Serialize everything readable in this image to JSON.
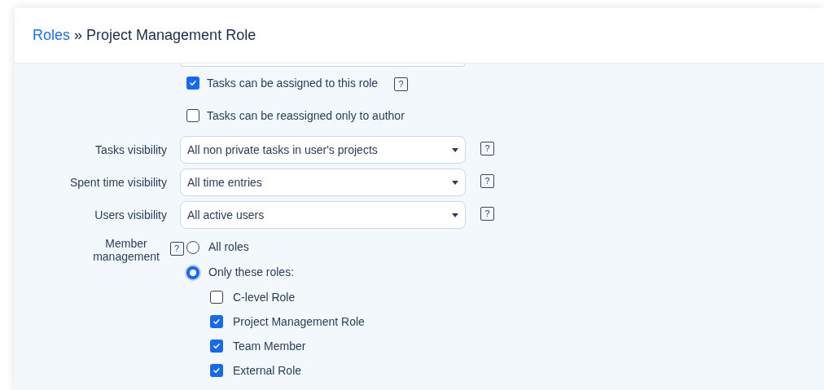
{
  "breadcrumb": {
    "link": "Roles",
    "separator": "»",
    "current": "Project Management Role"
  },
  "options": [
    {
      "label": "Tasks can be assigned to this role",
      "checked": true,
      "help": "?"
    },
    {
      "label": "Tasks can be reassigned only to author",
      "checked": false
    }
  ],
  "fields": [
    {
      "label": "Tasks visibility",
      "value": "All non private tasks in user's projects",
      "help": "?"
    },
    {
      "label": "Spent time visibility",
      "value": "All time entries",
      "help": "?"
    },
    {
      "label": "Users visibility",
      "value": "All active users",
      "help": "?"
    }
  ],
  "member_management": {
    "label": "Member management",
    "help": "?",
    "choices": [
      {
        "label": "All roles",
        "selected": false
      },
      {
        "label": "Only these roles:",
        "selected": true
      }
    ],
    "roles": [
      {
        "label": "C-level Role",
        "checked": false
      },
      {
        "label": "Project Management Role",
        "checked": true
      },
      {
        "label": "Team Member",
        "checked": true
      },
      {
        "label": "External Role",
        "checked": true
      }
    ]
  }
}
